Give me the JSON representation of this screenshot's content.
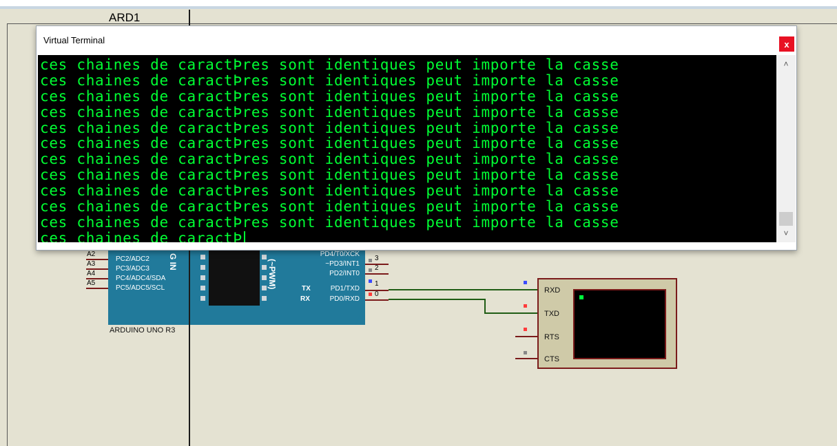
{
  "schematic": {
    "part_ref": "ARD1",
    "board_name": "ARDUINO UNO R3",
    "left_pins": [
      {
        "num": "A2",
        "label": "PC2/ADC2"
      },
      {
        "num": "A3",
        "label": "PC3/ADC3"
      },
      {
        "num": "A4",
        "label": "PC4/ADC4/SDA"
      },
      {
        "num": "A5",
        "label": "PC5/ADC5/SCL"
      }
    ],
    "right_pins": [
      {
        "num": "",
        "label": "PD4/T0/XCK"
      },
      {
        "num": "3",
        "label": "~PD3/INT1"
      },
      {
        "num": "2",
        "label": "PD2/INT0"
      },
      {
        "num": "1",
        "label": "PD1/TXD",
        "prefix": "TX"
      },
      {
        "num": "0",
        "label": "PD0/RXD",
        "prefix": "RX"
      }
    ],
    "pwm_label": "(~PWM)",
    "g_in_label": "G IN",
    "terminal_pins": [
      "RXD",
      "TXD",
      "RTS",
      "CTS"
    ]
  },
  "terminal_window": {
    "title": "Virtual Terminal",
    "close_label": "x",
    "lines": [
      "ces chaines de caractÞres sont identiques peut importe la casse",
      "ces chaines de caractÞres sont identiques peut importe la casse",
      "ces chaines de caractÞres sont identiques peut importe la casse",
      "ces chaines de caractÞres sont identiques peut importe la casse",
      "ces chaines de caractÞres sont identiques peut importe la casse",
      "ces chaines de caractÞres sont identiques peut importe la casse",
      "ces chaines de caractÞres sont identiques peut importe la casse",
      "ces chaines de caractÞres sont identiques peut importe la casse",
      "ces chaines de caractÞres sont identiques peut importe la casse",
      "ces chaines de caractÞres sont identiques peut importe la casse",
      "ces chaines de caractÞres sont identiques peut importe la casse",
      "ces chaines de caractÞ"
    ],
    "scroll_up_icon": "chevron-up-icon",
    "scroll_down_icon": "chevron-down-icon"
  },
  "colors": {
    "terminal_text": "#00ff33",
    "terminal_bg": "#000000",
    "board": "#217a9b",
    "close_button": "#e81123",
    "wire": "#1f5c14"
  }
}
